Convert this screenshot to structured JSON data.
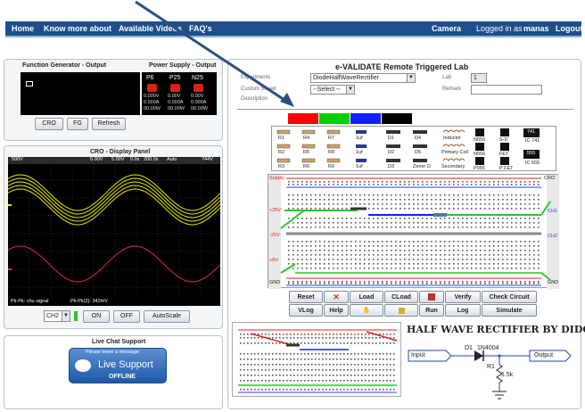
{
  "nav": {
    "home": "Home",
    "know_more": "Know more about",
    "videos": "Available Videos",
    "faq": "FAQ's",
    "camera": "Camera",
    "logged_in_prefix": "Logged in as",
    "username": "manas",
    "logout": "Logout"
  },
  "function_generator": {
    "title": "Function Generator - Output",
    "buttons": [
      "CRO",
      "FG",
      "Refresh"
    ]
  },
  "power_supply": {
    "title": "Power Supply - Output",
    "channels": [
      "P6",
      "P25",
      "N25"
    ],
    "rows": [
      [
        "0.000V",
        "0.00V",
        "0.00V"
      ],
      [
        "0.000A",
        "0.000A",
        "0.000A"
      ],
      [
        "00.00W",
        "00.00W",
        "00.00W"
      ]
    ]
  },
  "cro": {
    "title": "CRO - Display Panel",
    "status_left": "500V",
    "status_mid": [
      "5.00V",
      "5.00V",
      "0.0s",
      "200.0s"
    ],
    "status_right": "Auto",
    "status_level": "744V",
    "footer_left": "Pk-Pk: chu signal",
    "footer_mid": "Pk-Pk(2): 342mV",
    "channel_select": "CH2",
    "buttons": [
      "ON",
      "OFF",
      "AutoScale"
    ],
    "colors": {
      "ch1": "#e8e800",
      "ch2": "#e0207a"
    }
  },
  "live_chat": {
    "title": "Live Chat Support",
    "leave_message": "Please leave a message",
    "brand": "Live Support",
    "status": "OFFLINE"
  },
  "lab": {
    "title": "e-VALIDATE Remote Triggered Lab",
    "experiments_label": "Experiments",
    "experiment_value": "DiodeHalfWaveRectifier",
    "lab_label": "Lab",
    "lab_value": "1",
    "custom_saved_label": "Custom Saved",
    "custom_saved_value": "--Select --",
    "remark_label": "Remark",
    "description_label": "Description",
    "wire_colors": [
      "#ff0000",
      "#00d000",
      "#1020ff",
      "#000000"
    ],
    "components": [
      [
        "R1",
        "R4",
        "R7",
        "1uf",
        "D1",
        "D4",
        "Inductor",
        "N056",
        "S-D",
        "IC 741"
      ],
      [
        "R2",
        "R5",
        "R8",
        "1uf",
        "D2",
        "D5",
        "Primary Coil",
        "N056",
        "FET",
        "IC 555"
      ],
      [
        "R3",
        "R6",
        "R9",
        "1uf",
        "D3",
        "Zener D",
        "Secondary",
        "P055",
        "P FET",
        ""
      ]
    ],
    "ic_labels": [
      "741",
      "555"
    ],
    "board_labels": {
      "cro": "CRO",
      "ch1": "CH1",
      "ch2": "CH2",
      "gnd": "GND",
      "plus25": "+25V",
      "minus25": "-25V",
      "plus6": "+6V",
      "supply": "Supply"
    },
    "buttons_row1": [
      "Reset",
      "Load",
      "CLoad",
      "Verify",
      "Check Circuit"
    ],
    "buttons_row2": [
      "VLog",
      "Help",
      "Run",
      "Log",
      "Simulate"
    ],
    "circuit_title": "HALF WAVE RECTIFIER BY DIDOE",
    "circuit_input": "Input",
    "circuit_output": "Output",
    "circuit_diode_ref": "D1",
    "circuit_diode": "1N4004",
    "circuit_resistor_ref": "R1",
    "circuit_resistor": "1.5k"
  }
}
